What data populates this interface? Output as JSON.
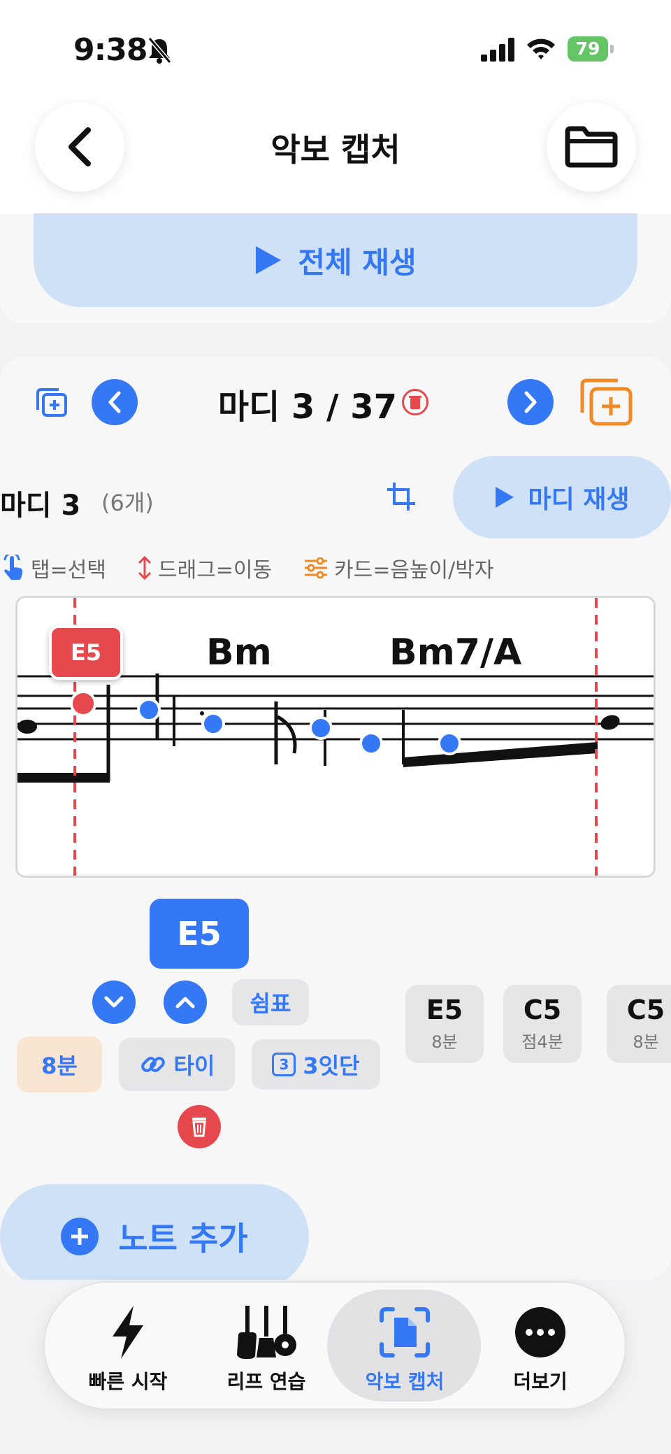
{
  "status": {
    "time": "9:38",
    "battery": "79"
  },
  "header": {
    "title": "악보 캡처"
  },
  "play_all_label": "전체 재생",
  "measure_nav": {
    "label": "마디 3 / 37"
  },
  "measure_section": {
    "title": "마디 3",
    "count": "(6개)",
    "play_label": "마디 재생"
  },
  "hints": {
    "tap": "탭=선택",
    "drag": "드래그=이동",
    "card": "카드=음높이/박자"
  },
  "score": {
    "chords": [
      "Bm",
      "Bm7/A"
    ],
    "selected_tag": "E5"
  },
  "editor": {
    "selected_note": "E5",
    "rest_label": "쉼표",
    "duration_label": "8분",
    "tie_label": "타이",
    "triplet_label": "3잇단",
    "triplet_badge": "3"
  },
  "note_cards": [
    {
      "note": "E5",
      "duration": "8분"
    },
    {
      "note": "C5",
      "duration": "점4분"
    },
    {
      "note": "C5",
      "duration": "8분"
    }
  ],
  "add_note_label": "노트 추가",
  "tabs": [
    {
      "label": "빠른 시작",
      "icon": "bolt-icon"
    },
    {
      "label": "리프 연습",
      "icon": "guitars-icon"
    },
    {
      "label": "악보 캡처",
      "icon": "doc-scan-icon",
      "active": true
    },
    {
      "label": "더보기",
      "icon": "more-icon"
    }
  ],
  "colors": {
    "accent": "#3478f6",
    "danger": "#e5484d",
    "light_accent": "#cfe1f7",
    "orange": "#f08a24"
  }
}
